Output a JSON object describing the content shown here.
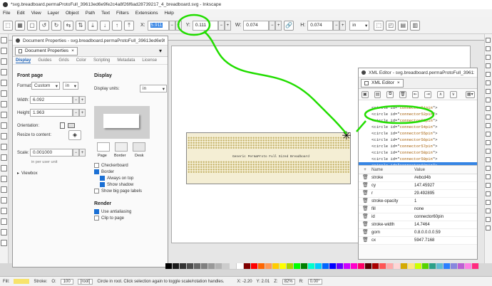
{
  "window": {
    "title": "*svg.breadboard.permaProtoFull_39613ed6e9fe2c4a8f26f6ad28739217_4_breadboard.svg - Inkscape"
  },
  "menu": [
    "File",
    "Edit",
    "View",
    "Layer",
    "Object",
    "Path",
    "Text",
    "Filters",
    "Extensions",
    "Help"
  ],
  "toolbar": {
    "x_label": "X:",
    "x_value": "5.911",
    "y_label": "Y:",
    "y_value": "0.111",
    "w_label": "W:",
    "w_value": "0.074",
    "h_label": "H:",
    "h_value": "0.074",
    "unit": "in"
  },
  "doc_props": {
    "window_title": "Document Properties - svg.breadboard.permaProtoFull_39613ed6e9fe2c4...",
    "tab_label": "Document Properties",
    "tabs": [
      "Display",
      "Guides",
      "Grids",
      "Color",
      "Scripting",
      "Metadata",
      "License"
    ],
    "front_page": "Front page",
    "format_label": "Format:",
    "format_value": "Custom",
    "format_unit": "in",
    "width_label": "Width:",
    "width_value": "6.092",
    "height_label": "Height:",
    "height_value": "1.963",
    "orientation_label": "Orientation:",
    "resize_label": "Resize to content:",
    "scale_label": "Scale:",
    "scale_value": "0.001000",
    "scale_note": "in per user unit",
    "viewbox": "Viewbox",
    "display_heading": "Display",
    "display_units_label": "Display units:",
    "display_units_value": "in",
    "preview_labels": [
      "Page",
      "Border",
      "Desk"
    ],
    "checks": [
      {
        "label": "Checkerboard",
        "on": false
      },
      {
        "label": "Border",
        "on": true
      },
      {
        "label": "Always on top",
        "on": true
      },
      {
        "label": "Show shadow",
        "on": true
      },
      {
        "label": "Show big page labels",
        "on": false
      }
    ],
    "render_heading": "Render",
    "render_checks": [
      {
        "label": "Use antialiasing",
        "on": true
      },
      {
        "label": "Clip to page",
        "on": false
      }
    ]
  },
  "xml_editor": {
    "window_title": "XML Editor - svg.breadboard.permaProtoFull_39613e...",
    "tab_label": "XML Editor",
    "nodes": [
      {
        "tag": "<circle id=\"",
        "id": "connector51pin",
        "end": "\">"
      },
      {
        "tag": "<circle id=\"",
        "id": "connector52pin",
        "end": "\">"
      },
      {
        "tag": "<circle id=\"",
        "id": "connector53pin",
        "end": "\">"
      },
      {
        "tag": "<circle id=\"",
        "id": "connector54pin",
        "end": "\">"
      },
      {
        "tag": "<circle id=\"",
        "id": "connector55pin",
        "end": "\">"
      },
      {
        "tag": "<circle id=\"",
        "id": "connector56pin",
        "end": "\">"
      },
      {
        "tag": "<circle id=\"",
        "id": "connector57pin",
        "end": "\">"
      },
      {
        "tag": "<circle id=\"",
        "id": "connector58pin",
        "end": "\">"
      },
      {
        "tag": "<circle id=\"",
        "id": "connector59pin",
        "end": "\">"
      },
      {
        "tag": "<circle id=\"",
        "id": "connector60pin",
        "end": "\">"
      }
    ],
    "attr_header_name": "Name",
    "attr_header_value": "Value",
    "attrs": [
      {
        "k": "stroke",
        "v": "#ebcd4b"
      },
      {
        "k": "cy",
        "v": "147.45927"
      },
      {
        "k": "r",
        "v": "29.492895"
      },
      {
        "k": "stroke-opacity",
        "v": "1"
      },
      {
        "k": "fill",
        "v": "none"
      },
      {
        "k": "id",
        "v": "connector60pin"
      },
      {
        "k": "stroke-width",
        "v": "14.7464"
      },
      {
        "k": "gorn",
        "v": "0.8.0.0.0.0.59"
      },
      {
        "k": "cx",
        "v": "5947.7168"
      }
    ]
  },
  "canvas": {
    "breadboard_label": "Generic PermaProto Full Sized Breadboard"
  },
  "status": {
    "fill_label": "Fill:",
    "stroke_label": "Stroke:",
    "opacity_label": "O:",
    "opacity_value": "100",
    "layer": "[root]",
    "message": "Circle  in root. Click selection again to toggle scale/rotation handles.",
    "x": "X: -2.20",
    "y": "Y: 2.01",
    "zoom_label": "Z:",
    "zoom": "82%",
    "rotation_label": "R:",
    "rotation": "0.00°"
  },
  "palette_colors": [
    "#000000",
    "#1a1a1a",
    "#333333",
    "#4d4d4d",
    "#666666",
    "#808080",
    "#999999",
    "#b3b3b3",
    "#cccccc",
    "#e6e6e6",
    "#ffffff",
    "#800000",
    "#ff0000",
    "#ff6600",
    "#ff9955",
    "#ffcc00",
    "#ffff00",
    "#aad400",
    "#00ff00",
    "#008000",
    "#00ffcc",
    "#00ccff",
    "#0066ff",
    "#0000ff",
    "#6600ff",
    "#cc00ff",
    "#ff00cc",
    "#ff0066",
    "#550000",
    "#aa0000",
    "#ff5555",
    "#ffaaaa",
    "#ffd5d5",
    "#d4aa00",
    "#ffe680",
    "#ccff00",
    "#55d400",
    "#2ca089",
    "#5fbcd3",
    "#2a7fff",
    "#8787de",
    "#bc5fd3",
    "#ff80e5",
    "#ff2a7f"
  ],
  "colors": {
    "accent": "#3584e4",
    "annotation": "#22dd00"
  }
}
